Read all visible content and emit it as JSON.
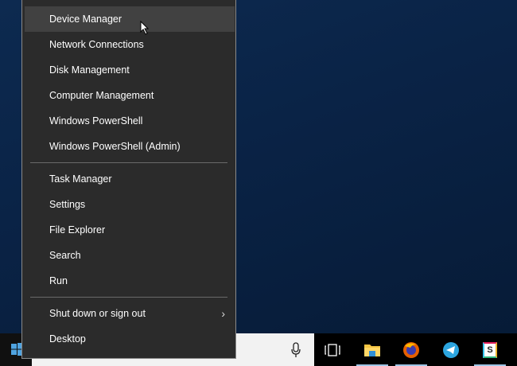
{
  "menu": {
    "items": [
      {
        "label": "Device Manager"
      },
      {
        "label": "Network Connections"
      },
      {
        "label": "Disk Management"
      },
      {
        "label": "Computer Management"
      },
      {
        "label": "Windows PowerShell"
      },
      {
        "label": "Windows PowerShell (Admin)"
      },
      {
        "label": "Task Manager"
      },
      {
        "label": "Settings"
      },
      {
        "label": "File Explorer"
      },
      {
        "label": "Search"
      },
      {
        "label": "Run"
      },
      {
        "label": "Shut down or sign out"
      },
      {
        "label": "Desktop"
      }
    ]
  },
  "taskbar": {
    "icons": [
      "windows-start-icon",
      "microphone-icon",
      "task-view-icon",
      "file-explorer-icon",
      "firefox-icon",
      "telegram-icon",
      "slack-icon"
    ],
    "slack_letter": "S"
  }
}
